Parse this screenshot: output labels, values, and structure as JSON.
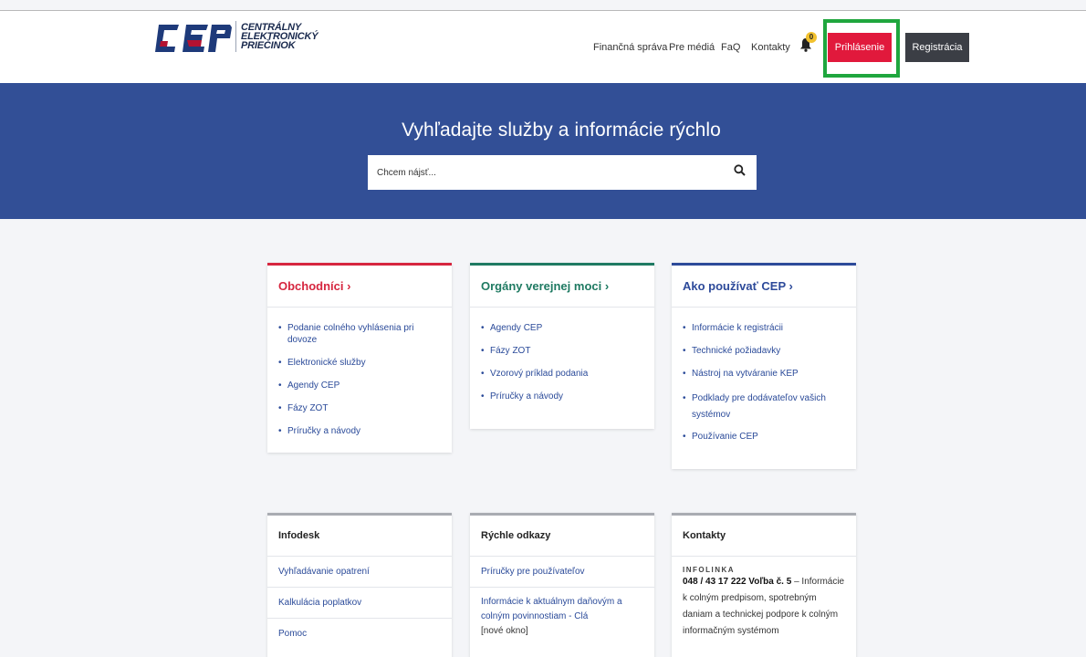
{
  "header": {
    "logo_lines": [
      "CENTRÁLNY",
      "ELEKTRONICKÝ",
      "PRIEČINOK"
    ],
    "logo_mark": "CEP",
    "nav": [
      {
        "label": "Finančná správa"
      },
      {
        "label": "Pre médiá"
      },
      {
        "label": "FaQ"
      },
      {
        "label": "Kontakty"
      }
    ],
    "notifications_count": "0",
    "login_label": "Prihlásenie",
    "register_label": "Registrácia"
  },
  "hero": {
    "title": "Vyhľadajte služby a informácie rýchlo",
    "search_placeholder": "Chcem nájsť..."
  },
  "cards": [
    {
      "title": "Obchodníci ›",
      "accent": "#d6263f",
      "title_color": "#d6263f",
      "items": [
        "Podanie colného vyhlásenia pri dovoze",
        "Elektronické služby",
        "Agendy CEP",
        "Fázy ZOT",
        "Príručky a návody"
      ]
    },
    {
      "title": "Orgány verejnej moci ›",
      "accent": "#1f7a62",
      "title_color": "#1f7a62",
      "items": [
        "Agendy CEP",
        "Fázy ZOT",
        "Vzorový príklad podania",
        "Príručky a návody"
      ]
    },
    {
      "title": "Ako používať CEP ›",
      "accent": "#2d4a9a",
      "title_color": "#2d4a9a",
      "items": [
        "Informácie k registrácii",
        "Technické požiadavky",
        "Nástroj na vytváranie KEP",
        "Podklady pre dodávateľov vašich systémov",
        "Používanie CEP"
      ]
    }
  ],
  "bottom": {
    "infodesk": {
      "title": "Infodesk",
      "links": [
        "Vyhľadávanie opatrení",
        "Kalkulácia poplatkov",
        "Pomoc"
      ]
    },
    "quick": {
      "title": "Rýchle odkazy",
      "link1": "Príručky pre používateľov",
      "link2": "Informácie k aktuálnym daňovým a colným povinnostiam - Clá",
      "link2_note": "[nové okno]"
    },
    "contacts": {
      "title": "Kontakty",
      "label": "INFOLINKA",
      "phone": "048 / 43 17 222 Voľba č. 5",
      "text": " – Informácie k colným predpisom, spotrebným daniam a technickej podpore k colným informačným systémom"
    }
  },
  "colors": {
    "hero_bg": "#324f96",
    "login_bg": "#e1193c",
    "register_bg": "#3b3e45",
    "highlight": "#1fa63e"
  }
}
